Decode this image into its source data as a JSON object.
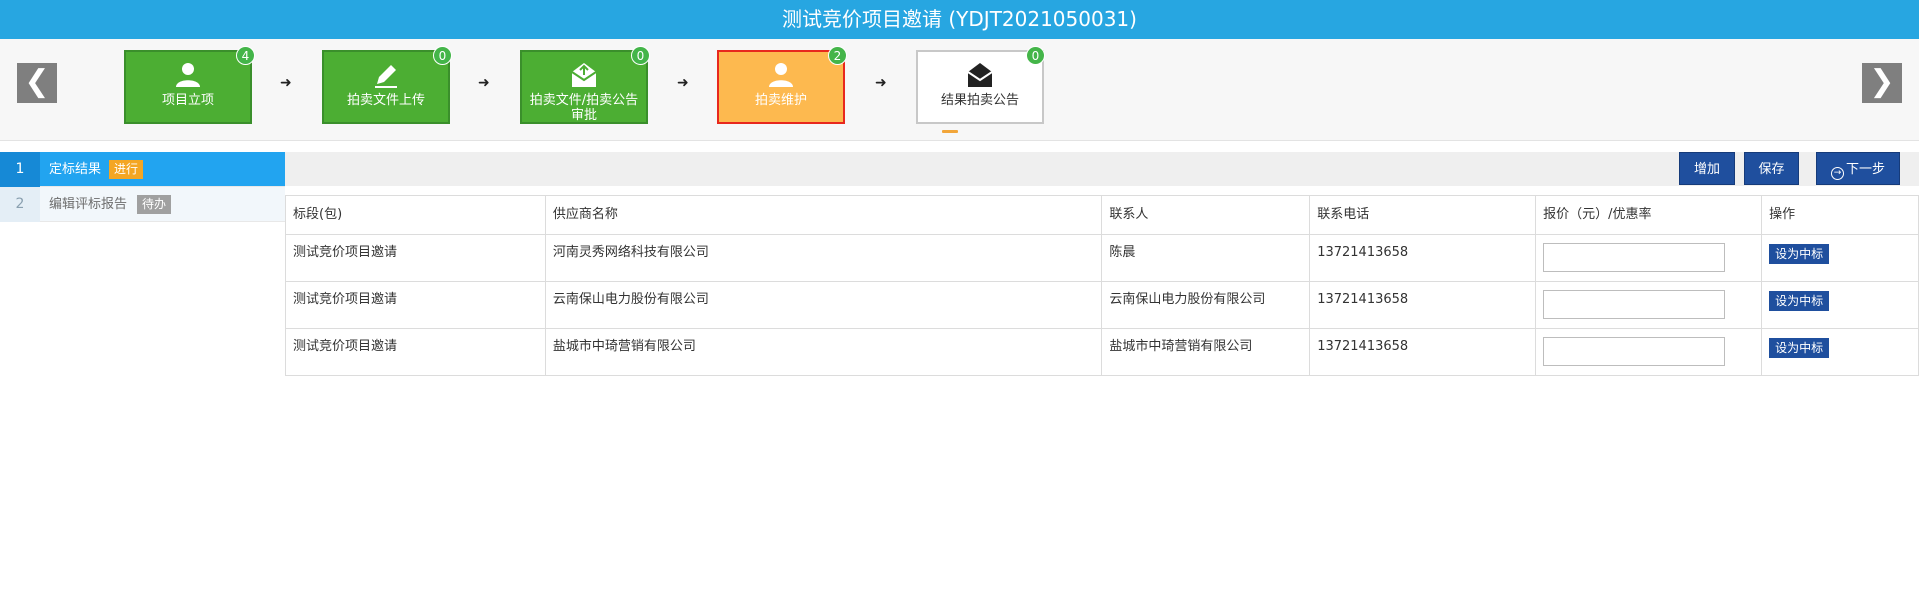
{
  "header": {
    "title": "测试竞价项目邀请 (YDJT2021050031)"
  },
  "nav": {
    "prev": "❮",
    "next": "❯"
  },
  "steps": [
    {
      "label": "项目立项",
      "badge": "4",
      "icon": "user-icon",
      "state": "done"
    },
    {
      "label": "拍卖文件上传",
      "badge": "0",
      "icon": "pencil-icon",
      "state": "done"
    },
    {
      "label": "拍卖文件/拍卖公告审批",
      "badge": "0",
      "icon": "mail-upload-icon",
      "state": "done"
    },
    {
      "label": "拍卖维护",
      "badge": "2",
      "icon": "user-icon",
      "state": "active"
    },
    {
      "label": "结果拍卖公告",
      "badge": "0",
      "icon": "envelope-icon",
      "state": "pending"
    }
  ],
  "step_arrow": "➜",
  "sidebar": {
    "items": [
      {
        "num": "1",
        "label": "定标结果",
        "tag": "进行"
      },
      {
        "num": "2",
        "label": "编辑评标报告",
        "tag": "待办"
      }
    ]
  },
  "toolbar": {
    "add": "增加",
    "save": "保存",
    "next": "下一步",
    "next_icon": "→"
  },
  "table": {
    "headers": [
      "标段(包)",
      "供应商名称",
      "联系人",
      "联系电话",
      "报价（元）/优惠率",
      "操作"
    ],
    "rows": [
      {
        "section": "测试竞价项目邀请",
        "supplier": "河南灵秀网络科技有限公司",
        "contact": "陈晨",
        "phone": "13721413658",
        "quote": "",
        "action": "设为中标"
      },
      {
        "section": "测试竞价项目邀请",
        "supplier": "云南保山电力股份有限公司",
        "contact": "云南保山电力股份有限公司",
        "phone": "13721413658",
        "quote": "",
        "action": "设为中标"
      },
      {
        "section": "测试竞价项目邀请",
        "supplier": "盐城市中琦营销有限公司",
        "contact": "盐城市中琦营销有限公司",
        "phone": "13721413658",
        "quote": "",
        "action": "设为中标"
      }
    ]
  },
  "colors": {
    "topbar": "#27a6e1",
    "step_done": "#4cae33",
    "step_active": "#fdb94f",
    "step_active_border": "#e8281d",
    "badge": "#44b549",
    "primary_button": "#1f4f9e",
    "sidebar_active": "#22a4f0",
    "tag_running": "#f4a623",
    "tag_todo": "#a0a0a0"
  }
}
